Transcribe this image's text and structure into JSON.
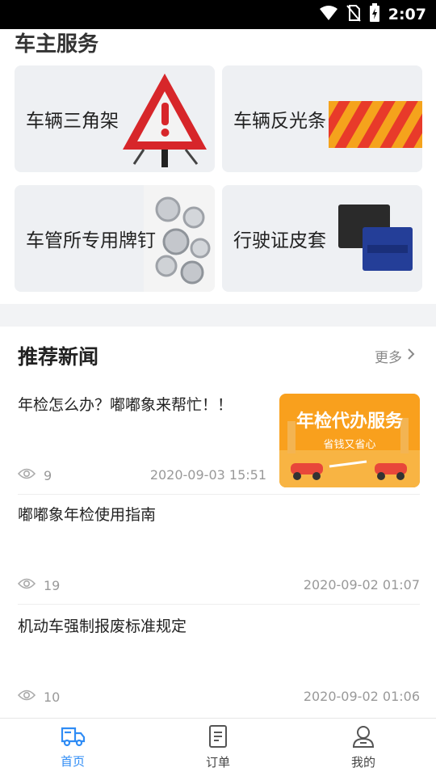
{
  "status_bar": {
    "time": "2:07"
  },
  "service": {
    "title": "车主服务",
    "cards": [
      {
        "label": "车辆三角架"
      },
      {
        "label": "车辆反光条"
      },
      {
        "label": "车管所专用牌钉"
      },
      {
        "label": "行驶证皮套"
      }
    ]
  },
  "news": {
    "title": "推荐新闻",
    "more": "更多",
    "items": [
      {
        "title": "年检怎么办？嘟嘟象来帮忙！！",
        "views": "9",
        "date": "2020-09-03 15:51",
        "thumb_title": "年检代办服务",
        "thumb_sub": "省钱又省心"
      },
      {
        "title": "嘟嘟象年检使用指南",
        "views": "19",
        "date": "2020-09-02 01:07"
      },
      {
        "title": "机动车强制报废标准规定",
        "views": "10",
        "date": "2020-09-02 01:06"
      }
    ]
  },
  "tabs": [
    {
      "label": "首页",
      "active": true
    },
    {
      "label": "订单",
      "active": false
    },
    {
      "label": "我的",
      "active": false
    }
  ],
  "colors": {
    "accent": "#2f8cf5",
    "orange": "#f7a21b",
    "red": "#d7262a"
  }
}
